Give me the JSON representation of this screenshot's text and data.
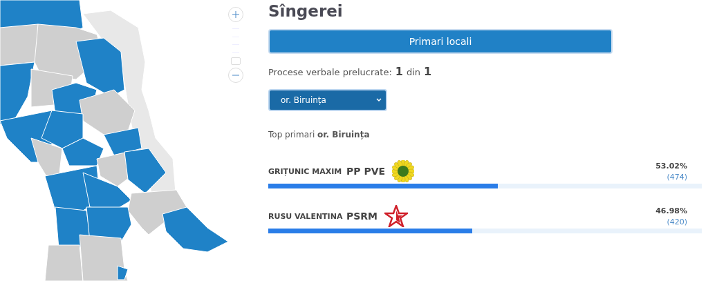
{
  "region": {
    "title": "Sîngerei"
  },
  "map_zoom": {
    "level": 0
  },
  "election_button": {
    "label": "Primari locali"
  },
  "progress": {
    "label": "Procese verbale prelucrate:",
    "processed": "1",
    "of": "din",
    "total": "1"
  },
  "locality_select": {
    "value": "or. Biruința"
  },
  "top_heading": "Top primari **or. Biruința**",
  "candidates": [
    {
      "name": "GRIȚUNIC MAXIM",
      "party": "PP PVE",
      "percent": "53.02%",
      "votes": "(474)",
      "level": 0.53
    },
    {
      "name": "RUSU VALENTINA",
      "party": "PSRM",
      "percent": "46.98%",
      "votes": "(420)",
      "level": 0.47
    }
  ]
}
